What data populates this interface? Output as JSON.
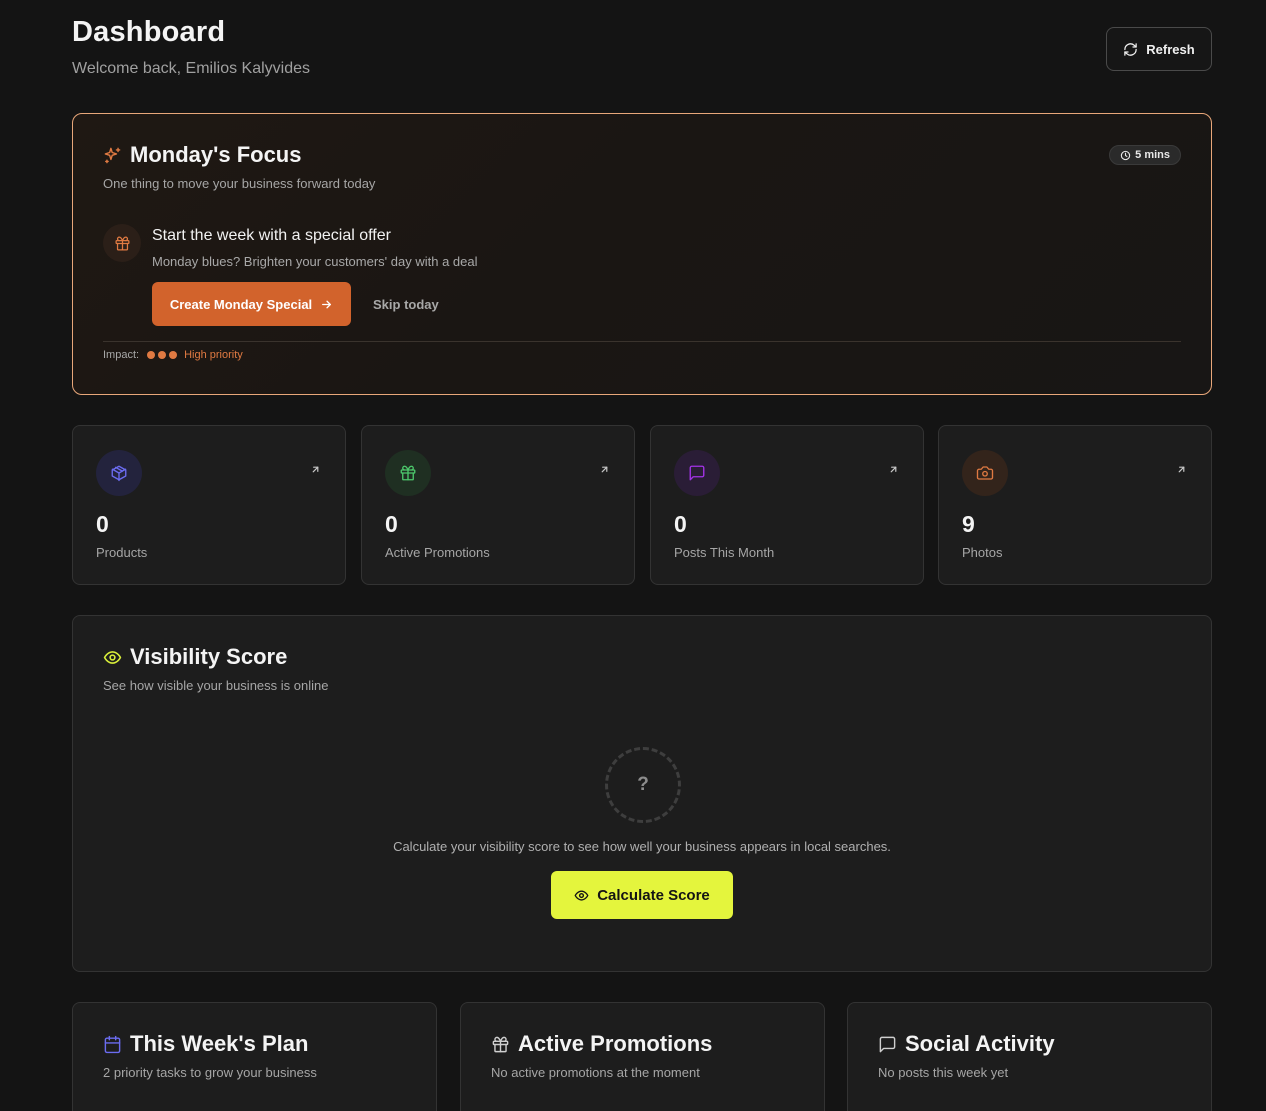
{
  "header": {
    "title": "Dashboard",
    "subtitle": "Welcome back, Emilios Kalyvides",
    "refresh_label": "Refresh"
  },
  "focus": {
    "title": "Monday's Focus",
    "subtitle": "One thing to move your business forward today",
    "time_badge": "5 mins",
    "offer_title": "Start the week with a special offer",
    "offer_subtitle": "Monday blues? Brighten your customers' day with a deal",
    "primary_label": "Create Monday Special",
    "skip_label": "Skip today",
    "impact_label": "Impact:",
    "impact_level": 3,
    "priority_label": "High priority"
  },
  "stats": [
    {
      "value": "0",
      "label": "Products",
      "icon": "package-icon",
      "color": "#6b6cf0"
    },
    {
      "value": "0",
      "label": "Active Promotions",
      "icon": "gift-icon",
      "color": "#4cc76b"
    },
    {
      "value": "0",
      "label": "Posts This Month",
      "icon": "message-icon",
      "color": "#a433e8"
    },
    {
      "value": "9",
      "label": "Photos",
      "icon": "camera-icon",
      "color": "#e07a42"
    }
  ],
  "visibility": {
    "title": "Visibility Score",
    "subtitle": "See how visible your business is online",
    "placeholder_symbol": "?",
    "message": "Calculate your visibility score to see how well your business appears in local searches.",
    "button_label": "Calculate Score"
  },
  "bottom_cards": [
    {
      "title": "This Week's Plan",
      "subtitle": "2 priority tasks to grow your business",
      "icon": "calendar-icon"
    },
    {
      "title": "Active Promotions",
      "subtitle": "No active promotions at the moment",
      "icon": "gift-icon"
    },
    {
      "title": "Social Activity",
      "subtitle": "No posts this week yet",
      "icon": "message-icon"
    }
  ],
  "colors": {
    "accent_orange": "#d2632c",
    "accent_lime": "#e4f53d",
    "background": "#141414"
  }
}
